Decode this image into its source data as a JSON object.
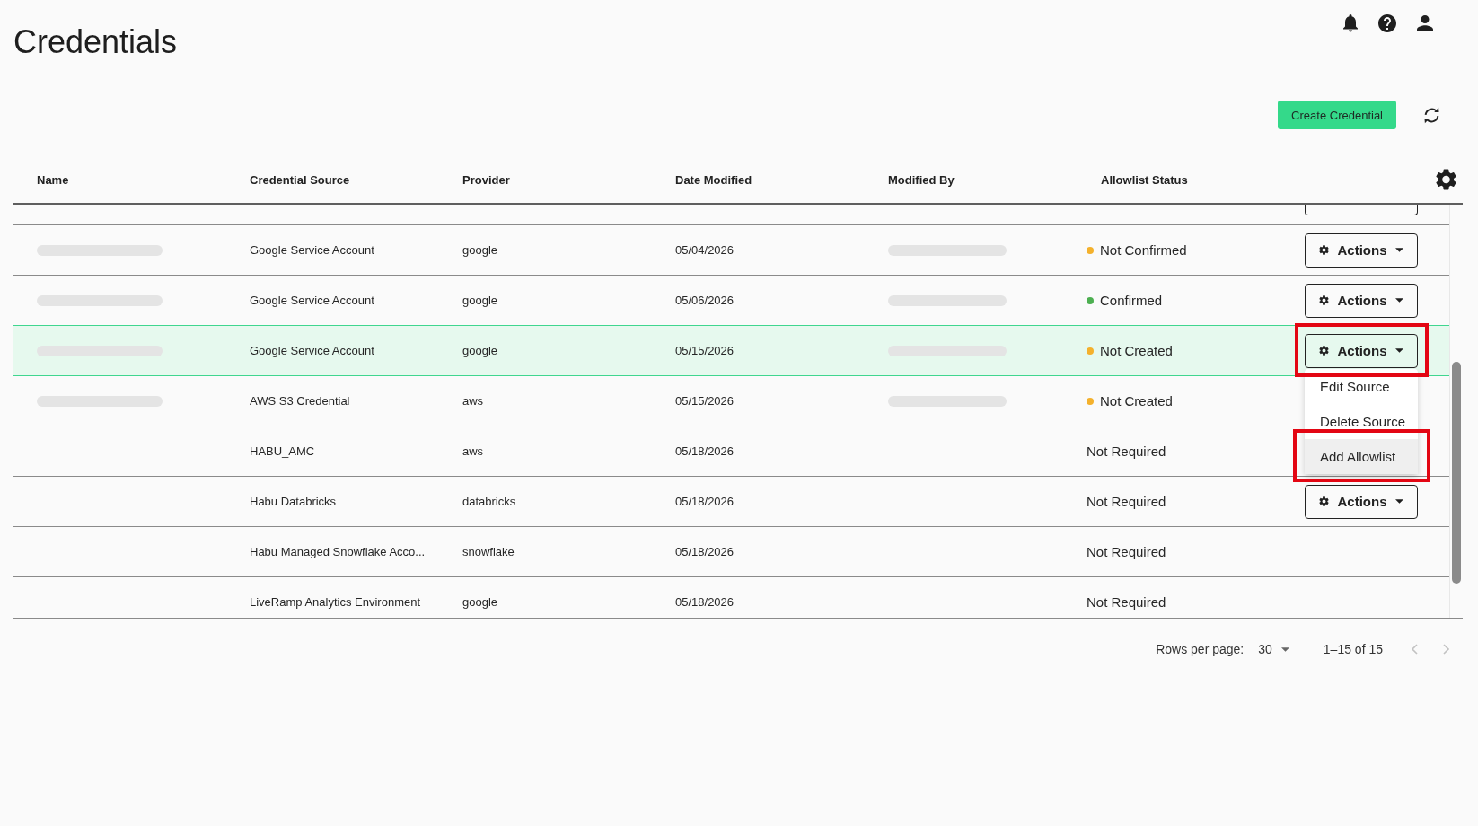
{
  "page": {
    "title": "Credentials"
  },
  "toolbar": {
    "create_button": "Create Credential"
  },
  "table": {
    "columns": [
      "Name",
      "Credential Source",
      "Provider",
      "Date Modified",
      "Modified By",
      "Allowlist Status"
    ],
    "clipped_row_above": true,
    "rows": [
      {
        "name_blurred": true,
        "source": "Google Service Account",
        "provider": "google",
        "date": "05/04/2026",
        "modified_by_blurred": true,
        "status": {
          "label": "Not Confirmed",
          "color": "#f4b12c"
        },
        "selected": false,
        "actions": {
          "label": "Actions",
          "annotated": false
        }
      },
      {
        "name_blurred": true,
        "source": "Google Service Account",
        "provider": "google",
        "date": "05/06/2026",
        "modified_by_blurred": true,
        "status": {
          "label": "Confirmed",
          "color": "#4caf50"
        },
        "selected": false,
        "actions": {
          "label": "Actions",
          "annotated": false
        }
      },
      {
        "name_blurred": true,
        "source": "Google Service Account",
        "provider": "google",
        "date": "05/15/2026",
        "modified_by_blurred": true,
        "status": {
          "label": "Not Created",
          "color": "#f4b12c"
        },
        "selected": true,
        "actions": {
          "label": "Actions",
          "annotated": true,
          "menu": [
            {
              "label": "Edit Source",
              "selected": false,
              "annotated": false
            },
            {
              "label": "Delete Source",
              "selected": false,
              "annotated": false
            },
            {
              "label": "Add Allowlist",
              "selected": true,
              "annotated": true
            }
          ]
        }
      },
      {
        "name_blurred": true,
        "source": "AWS S3 Credential",
        "provider": "aws",
        "date": "05/15/2026",
        "modified_by_blurred": true,
        "status": {
          "label": "Not Created",
          "color": "#f4b12c"
        },
        "selected": false
      },
      {
        "name_blurred": false,
        "source": "HABU_AMC",
        "provider": "aws",
        "date": "05/18/2026",
        "modified_by_blurred": false,
        "status": {
          "label": "Not Required"
        },
        "selected": false
      },
      {
        "name_blurred": false,
        "source": "Habu Databricks",
        "provider": "databricks",
        "date": "05/18/2026",
        "modified_by_blurred": false,
        "status": {
          "label": "Not Required"
        },
        "selected": false,
        "actions": {
          "label": "Actions",
          "annotated": false
        }
      },
      {
        "name_blurred": false,
        "source": "Habu Managed Snowflake Acco...",
        "provider": "snowflake",
        "date": "05/18/2026",
        "modified_by_blurred": false,
        "status": {
          "label": "Not Required"
        },
        "selected": false
      },
      {
        "name_blurred": false,
        "source": "LiveRamp Analytics Environment",
        "provider": "google",
        "date": "05/18/2026",
        "modified_by_blurred": false,
        "status": {
          "label": "Not Required"
        },
        "selected": false
      }
    ]
  },
  "pagination": {
    "label": "Rows per page:",
    "rows_per_page": "30",
    "range": "1–15 of 15",
    "prev_disabled": true,
    "next_disabled": true
  }
}
